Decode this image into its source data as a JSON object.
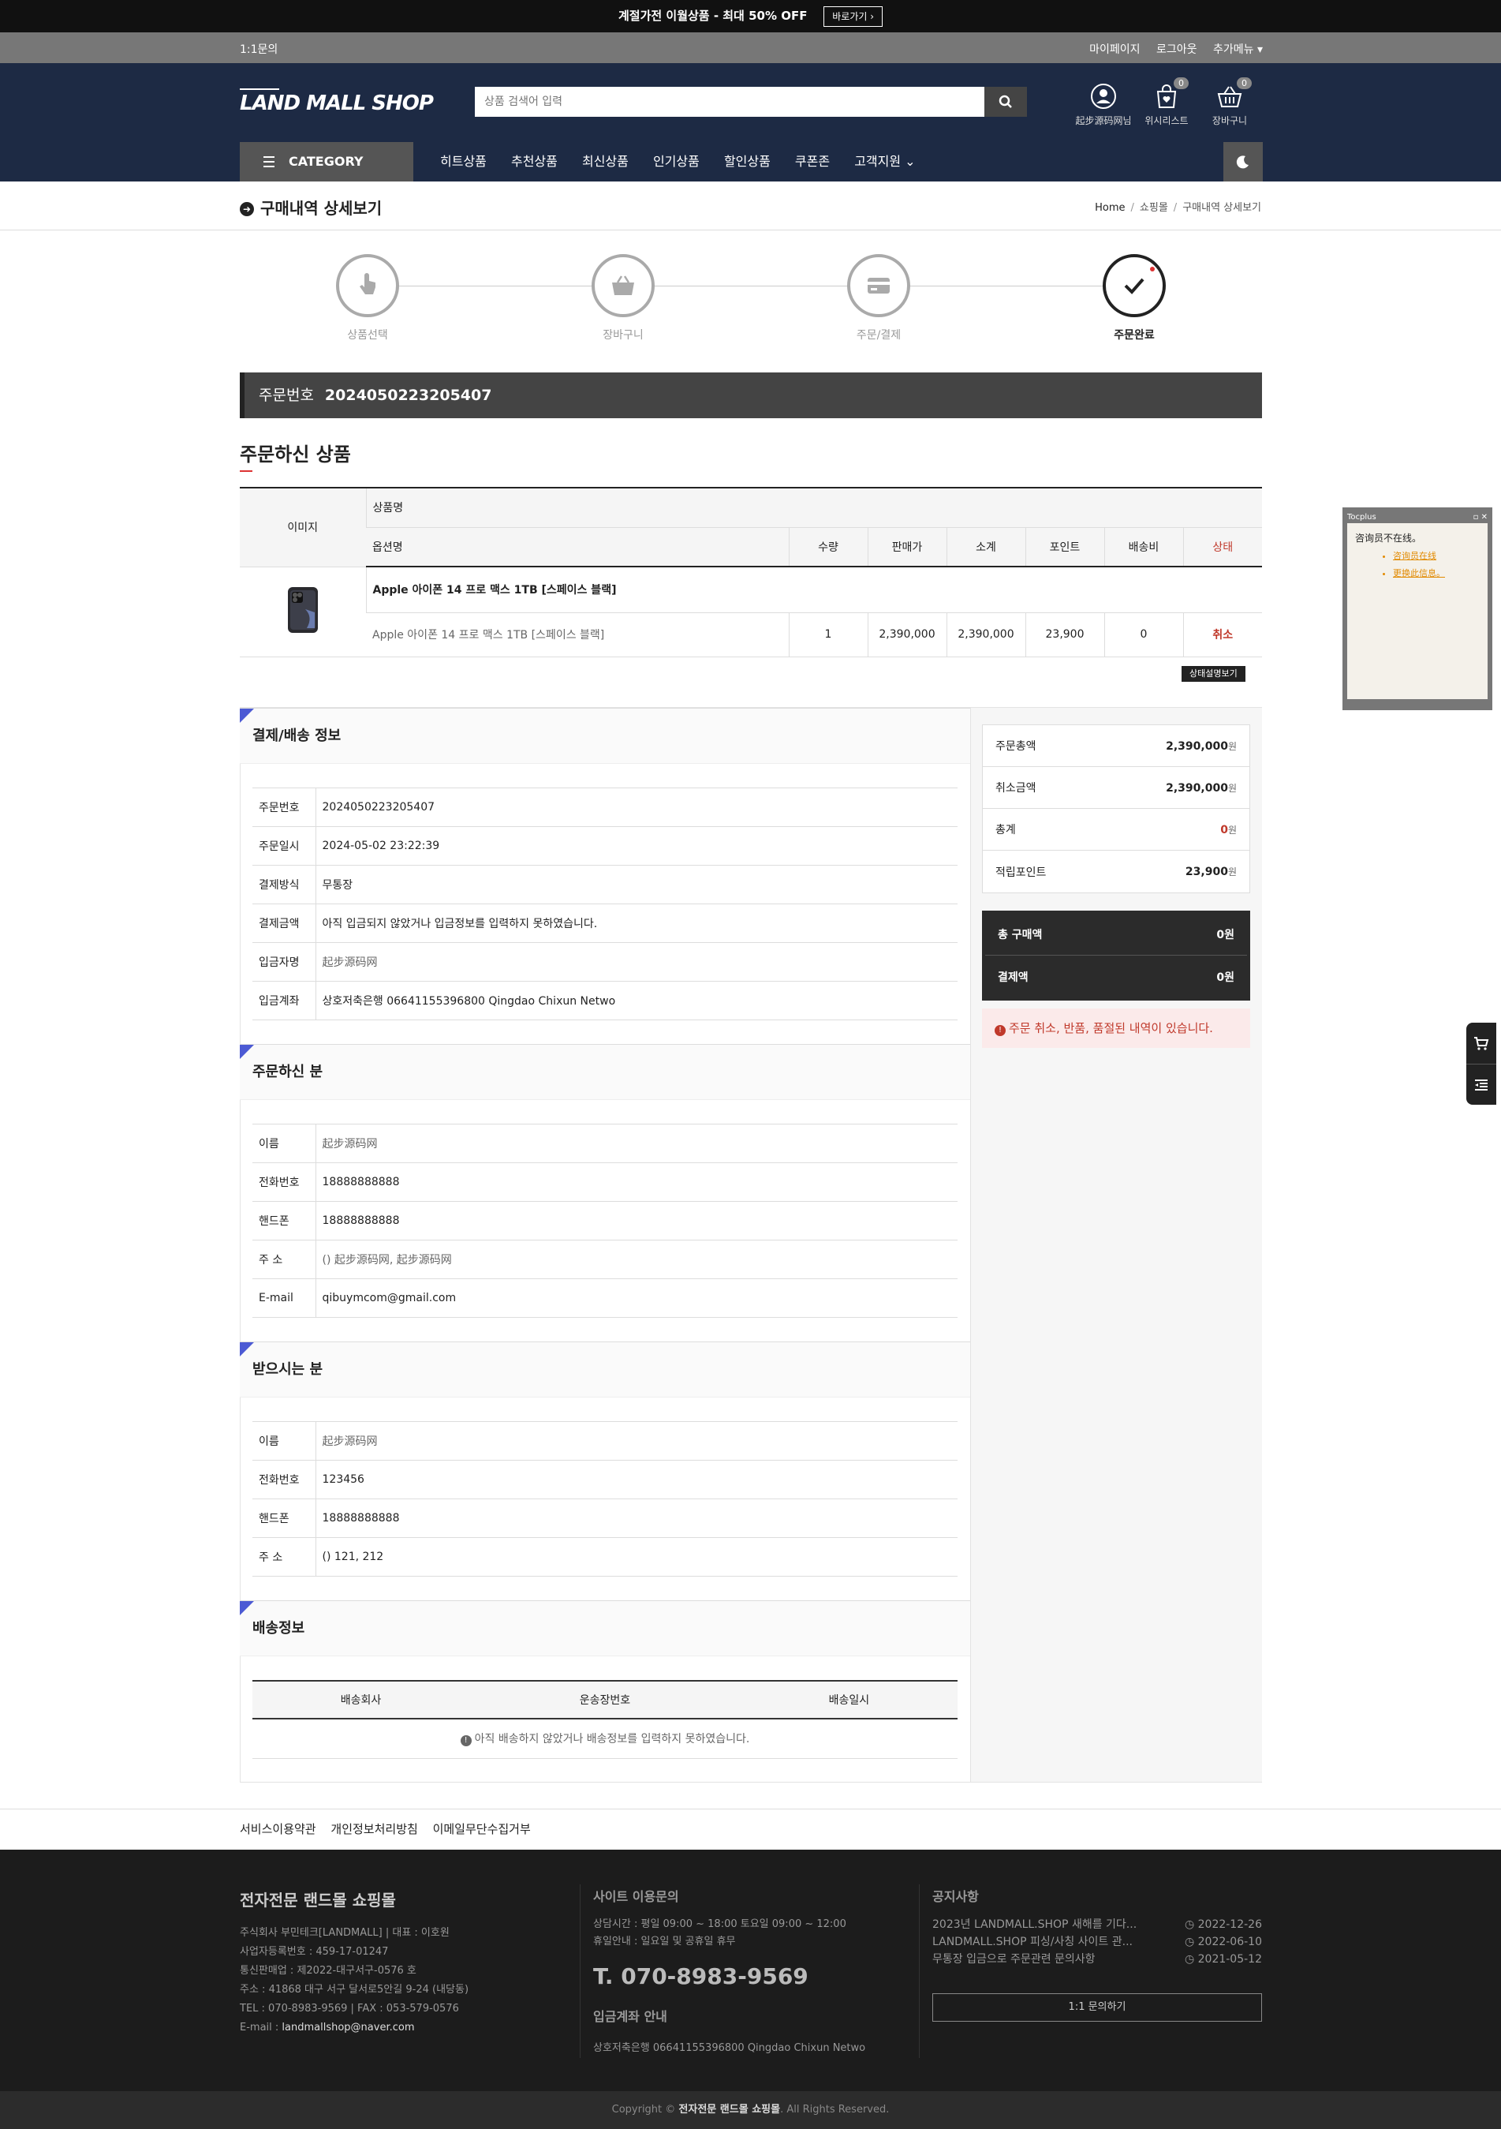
{
  "banner": {
    "text": "계절가전 이월상품 - 최대 50% OFF",
    "button": "바로가기 ›"
  },
  "util": {
    "left": "1:1문의",
    "mypage": "마이페이지",
    "logout": "로그아웃",
    "more": "추가메뉴 ▾"
  },
  "logo": {
    "text": "LAND MALL SHOP"
  },
  "search": {
    "placeholder": "상품 검색어 입력"
  },
  "header_icons": {
    "user": "起步源码网님",
    "wishlist": "위시리스트",
    "wish_count": "0",
    "cart": "장바구니",
    "cart_count": "0"
  },
  "nav": {
    "category": "CATEGORY",
    "items": [
      "히트상품",
      "추천상품",
      "최신상품",
      "인기상품",
      "할인상품",
      "쿠폰존",
      "고객지원 ⌄"
    ]
  },
  "page": {
    "title": "구매내역 상세보기",
    "breadcrumb": [
      "Home",
      "쇼핑몰",
      "구매내역 상세보기"
    ]
  },
  "steps": [
    {
      "label": "상품선택"
    },
    {
      "label": "장바구니"
    },
    {
      "label": "주문/결제"
    },
    {
      "label": "주문완료"
    }
  ],
  "order": {
    "label": "주문번호",
    "number": "2024050223205407"
  },
  "products": {
    "title": "주문하신 상품",
    "headers": {
      "image": "이미지",
      "name": "상품명",
      "option": "옵션명",
      "qty": "수량",
      "price": "판매가",
      "subtotal": "소계",
      "point": "포인트",
      "shipping": "배송비",
      "status": "상태"
    },
    "item": {
      "name": "Apple 아이폰 14 프로 맥스 1TB [스페이스 블랙]",
      "option": "Apple 아이폰 14 프로 맥스 1TB [스페이스 블랙]",
      "qty": "1",
      "price": "2,390,000",
      "subtotal": "2,390,000",
      "point": "23,900",
      "shipping": "0",
      "status": "취소"
    },
    "status_btn": "상태설명보기"
  },
  "payment": {
    "title": "결제/배송 정보",
    "rows": [
      {
        "k": "주문번호",
        "v": "2024050223205407"
      },
      {
        "k": "주문일시",
        "v": "2024-05-02 23:22:39"
      },
      {
        "k": "결제방식",
        "v": "무통장"
      },
      {
        "k": "결제금액",
        "v": "아직 입금되지 않았거나 입금정보를 입력하지 못하였습니다."
      },
      {
        "k": "입금자명",
        "v": "起步源码网"
      },
      {
        "k": "입금계좌",
        "v": "상호저축은행 06641155396800 Qingdao Chixun Netwo"
      }
    ]
  },
  "orderer": {
    "title": "주문하신 분",
    "rows": [
      {
        "k": "이름",
        "v": "起步源码网"
      },
      {
        "k": "전화번호",
        "v": "18888888888"
      },
      {
        "k": "핸드폰",
        "v": "18888888888"
      },
      {
        "k": "주 소",
        "v": "() 起步源码网, 起步源码网"
      },
      {
        "k": "E-mail",
        "v": "qibuymcom@gmail.com"
      }
    ]
  },
  "receiver": {
    "title": "받으시는 분",
    "rows": [
      {
        "k": "이름",
        "v": "起步源码网"
      },
      {
        "k": "전화번호",
        "v": "123456"
      },
      {
        "k": "핸드폰",
        "v": "18888888888"
      },
      {
        "k": "주 소",
        "v": "() 121, 212"
      }
    ]
  },
  "delivery": {
    "title": "배송정보",
    "headers": [
      "배송회사",
      "운송장번호",
      "배송일시"
    ],
    "empty": "아직 배송하지 않았거나 배송정보를 입력하지 못하였습니다."
  },
  "summary": {
    "rows": [
      {
        "k": "주문총액",
        "v": "2,390,000",
        "u": "원"
      },
      {
        "k": "취소금액",
        "v": "2,390,000",
        "u": "원"
      },
      {
        "k": "총계",
        "v": "0",
        "u": "원"
      },
      {
        "k": "적립포인트",
        "v": "23,900",
        "u": "원"
      }
    ],
    "dark": [
      {
        "k": "총 구매액",
        "v": "0원"
      },
      {
        "k": "결제액",
        "v": "0원"
      }
    ],
    "warning": "주문 취소, 반품, 품절된 내역이 있습니다."
  },
  "footer_links": [
    "서비스이용약관",
    "개인정보처리방침",
    "이메일무단수집거부"
  ],
  "footer": {
    "company": "전자전문 랜드몰 쇼핑몰",
    "info": [
      "주식회사 부민테크[LANDMALL]  |  대표 : 이호원",
      "사업자등록번호 : 459-17-01247",
      "통신판매업 : 제2022-대구서구-0576 호",
      "주소 : 41868 대구 서구 달서로5안길 9-24 (내당동)",
      "TEL : 070-8983-9569  |  FAX : 053-579-0576"
    ],
    "email_label": "E-mail : ",
    "email": "landmallshop@naver.com",
    "cs_title": "사이트 이용문의",
    "cs_hours": "상담시간 : 평일 09:00 ~ 18:00 토요일 09:00 ~ 12:00",
    "cs_holiday": "휴일안내 : 일요일 및 공휴일 휴무",
    "phone": "T. 070-8983-9569",
    "bank_title": "입금계좌 안내",
    "bank": "상호저축은행 06641155396800 Qingdao Chixun Netwo",
    "notice_title": "공지사항",
    "notices": [
      {
        "t": "2023년 LANDMALL.SHOP 새해를 기다...",
        "d": "2022-12-26"
      },
      {
        "t": "LANDMALL.SHOP 피싱/사칭 사이트 관...",
        "d": "2022-06-10"
      },
      {
        "t": "무통장 입금으로 주문관련 문의사항",
        "d": "2021-05-12"
      }
    ],
    "inquiry_btn": "1:1 문의하기"
  },
  "copyright": {
    "prefix": "Copyright © ",
    "name": "전자전문 랜드몰 쇼핑몰",
    "suffix": ". All Rights Reserved."
  },
  "tocplus": {
    "title": "Tocplus",
    "status": "咨询员不在线。",
    "links": [
      "咨询员在线",
      "更换此信息。"
    ]
  }
}
